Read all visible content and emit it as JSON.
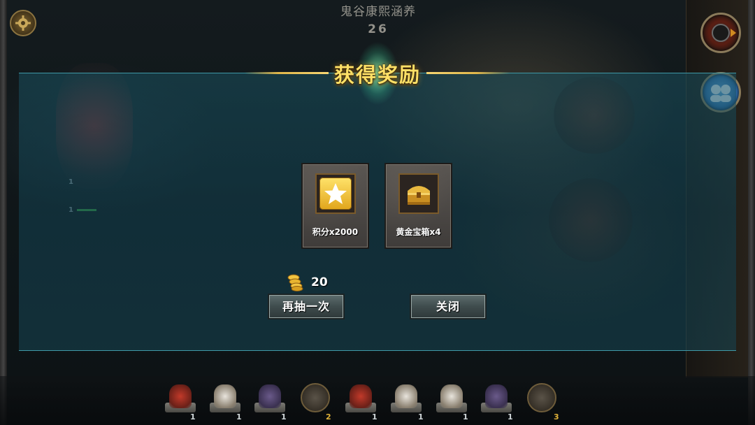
{
  "header": {
    "location_name": "鬼谷康熙涵养",
    "counter": "26"
  },
  "dialog": {
    "title": "获得奖励",
    "rewards": [
      {
        "icon": "star-icon",
        "label": "积分x2000"
      },
      {
        "icon": "gold-chest-icon",
        "label": "黄金宝箱x4"
      }
    ],
    "cost": {
      "icon": "gold-coins-icon",
      "value": "20"
    },
    "buttons": {
      "draw_again": "再抽一次",
      "close": "关闭"
    }
  },
  "battlefield": {
    "left_unit_counts": [
      "1",
      "1"
    ]
  },
  "unit_bar": {
    "slots": [
      {
        "type": "cavalry-red",
        "count": "1"
      },
      {
        "type": "cavalry-white",
        "count": "1"
      },
      {
        "type": "infantry",
        "count": "1"
      },
      {
        "type": "hourglass",
        "count": "2"
      },
      {
        "type": "cavalry-red",
        "count": "1"
      },
      {
        "type": "cavalry-white",
        "count": "1"
      },
      {
        "type": "cavalry-white",
        "count": "1"
      },
      {
        "type": "infantry",
        "count": "1"
      },
      {
        "type": "hourglass",
        "count": "3"
      }
    ]
  },
  "colors": {
    "title_gold": "#ffe066",
    "panel_teal": "#1a5a6a",
    "count_gold": "#e0b238"
  }
}
